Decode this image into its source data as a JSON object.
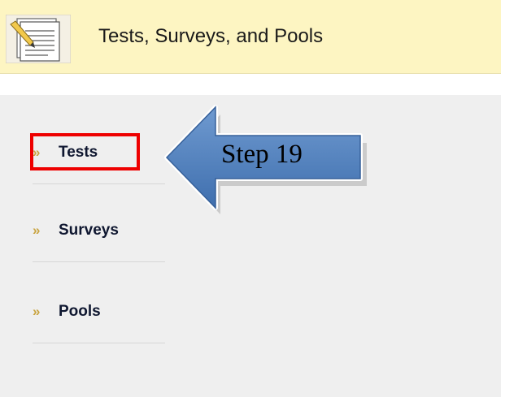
{
  "header": {
    "title": "Tests, Surveys, and Pools",
    "icon": "notepad-pencil-icon"
  },
  "nav": {
    "arrow_glyph": "»",
    "items": [
      {
        "label": "Tests",
        "icon": "double-chevron-right-icon"
      },
      {
        "label": "Surveys",
        "icon": "double-chevron-right-icon"
      },
      {
        "label": "Pools",
        "icon": "double-chevron-right-icon"
      }
    ]
  },
  "annotation": {
    "callout_text": "Step 19",
    "arrow_color": "#4f81bd",
    "highlight_color": "#ee0000"
  },
  "colors": {
    "header_bg": "#fdf5c2",
    "content_bg": "#efefef",
    "nav_arrow": "#c9a441",
    "nav_text": "#0f1730"
  }
}
